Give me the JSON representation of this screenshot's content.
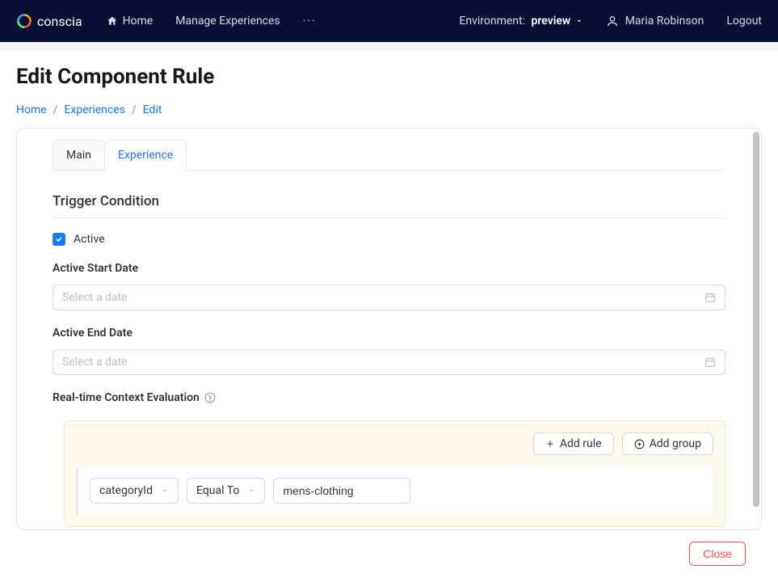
{
  "nav": {
    "brand": "conscia",
    "home": "Home",
    "manage": "Manage Experiences",
    "env_label": "Environment:",
    "env_value": "preview",
    "user": "Maria Robinson",
    "logout": "Logout"
  },
  "page": {
    "title": "Edit Component Rule"
  },
  "breadcrumb": {
    "home": "Home",
    "experiences": "Experiences",
    "edit": "Edit"
  },
  "tabs": {
    "main": "Main",
    "experience": "Experience"
  },
  "section": {
    "trigger_title": "Trigger Condition",
    "active_label": "Active",
    "start_date_label": "Active Start Date",
    "end_date_label": "Active End Date",
    "date_placeholder": "Select a date",
    "rtce_label": "Real-time Context Evaluation"
  },
  "rule_builder": {
    "add_rule": "Add rule",
    "add_group": "Add group",
    "field": "categoryId",
    "operator": "Equal To",
    "value": "mens-clothing"
  },
  "footer": {
    "close": "Close"
  }
}
